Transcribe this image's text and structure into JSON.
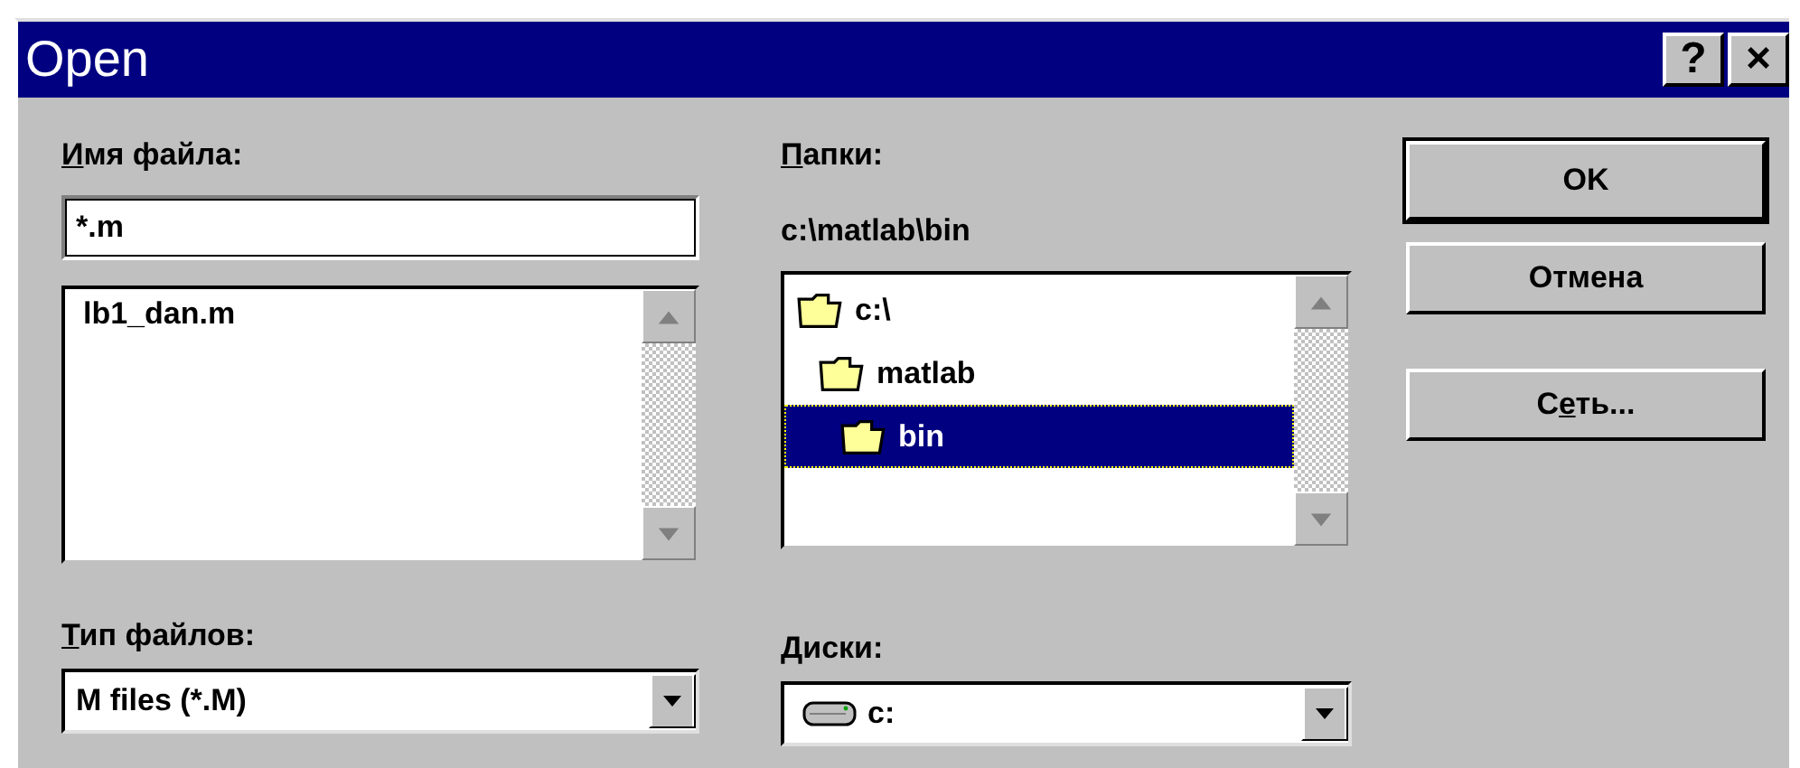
{
  "window": {
    "title": "Open",
    "title_buttons": [
      "?",
      "×"
    ]
  },
  "file_name": {
    "label": {
      "accel": "И",
      "rest": "мя файла:"
    },
    "value": "*.m"
  },
  "files": [
    "lb1_dan.m"
  ],
  "folders": {
    "label": {
      "accel": "П",
      "rest": "апки:"
    },
    "path": "c:\\matlab\\bin",
    "tree": [
      {
        "name": "c:\\",
        "selected": false,
        "children": [
          {
            "name": "matlab",
            "selected": false,
            "children": [
              {
                "name": "bin",
                "selected": true
              }
            ]
          }
        ]
      }
    ]
  },
  "file_type": {
    "label": {
      "accel": "Т",
      "rest": "ип файлов:"
    },
    "value": "M files (*.M)"
  },
  "drives": {
    "label": {
      "accel": "Д",
      "rest": "иски:"
    },
    "value": "c:"
  },
  "buttons": [
    {
      "pre": "OK",
      "default": true
    },
    {
      "pre": "Отмена",
      "default": false
    },
    {
      "pre": "С",
      "accel": "е",
      "post": "ть...",
      "default": false
    }
  ]
}
